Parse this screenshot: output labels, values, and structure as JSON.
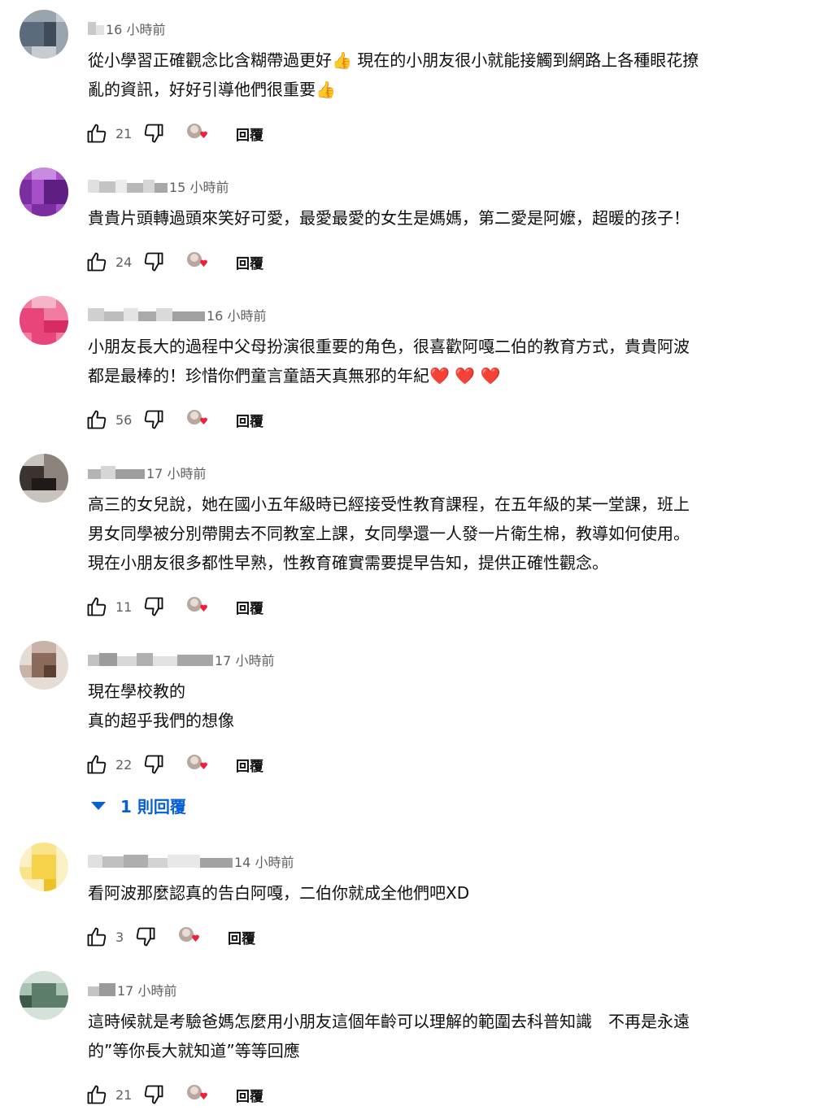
{
  "labels": {
    "reply": "回覆"
  },
  "colors": {
    "link": "#065fd4",
    "heart": "#e0245e",
    "meta": "#606060"
  },
  "comments": [
    {
      "time": "16 小時前",
      "lines": [
        "從小學習正確觀念比含糊帶過更好👍 現在的小朋友很小就能接觸到網路上各種眼花撩",
        "亂的資訊，好好引導他們很重要👍"
      ],
      "likes": "21",
      "avatar_colors": [
        "#5b6b7c",
        "#9aa4ae",
        "#3f4b58",
        "#c7ccd2"
      ]
    },
    {
      "time": "15 小時前",
      "lines": [
        "貴貴片頭轉過頭來笑好可愛，最愛最愛的女生是媽媽，第二愛是阿嬤，超暖的孩子！"
      ],
      "likes": "24",
      "avatar_colors": [
        "#7a2ea0",
        "#a64fc8",
        "#5e1f82",
        "#c98be0"
      ]
    },
    {
      "time": "16 小時前",
      "lines": [
        "小朋友長大的過程中父母扮演很重要的角色，很喜歡阿嘎二伯的教育方式，貴貴阿波",
        "都是最棒的！珍惜你們童言童語天真無邪的年紀❤️ ❤️ ❤️"
      ],
      "likes": "56",
      "avatar_colors": [
        "#e8467a",
        "#f27ba2",
        "#d62c63",
        "#f7b3c8"
      ]
    },
    {
      "time": "17 小時前",
      "lines": [
        "高三的女兒說，她在國小五年級時已經接受性教育課程，在五年級的某一堂課，班上",
        "男女同學被分別帶開去不同教室上課，女同學還一人發一片衛生棉，教導如何使用。",
        "現在小朋友很多都性早熟，性教育確實需要提早告知，提供正確性觀念。"
      ],
      "likes": "11",
      "avatar_colors": [
        "#3a3330",
        "#8c847c",
        "#1e1a18",
        "#c9c3bd"
      ]
    },
    {
      "time": "17 小時前",
      "lines": [
        "現在學校教的",
        "真的超乎我們的想像"
      ],
      "likes": "22",
      "avatar_colors": [
        "#8a6a5a",
        "#c9b3a8",
        "#5a3f33",
        "#e6dcd6"
      ],
      "replies_label": "1 則回覆"
    },
    {
      "time": "14 小時前",
      "lines": [
        "看阿波那麼認真的告白阿嘎，二伯你就成全他們吧XD"
      ],
      "likes": "3",
      "avatar_colors": [
        "#f5d24a",
        "#f9e48c",
        "#eec12a",
        "#fcf1c4"
      ]
    },
    {
      "time": "17 小時前",
      "lines": [
        "這時候就是考驗爸媽怎麼用小朋友這個年齡可以理解的範圍去科普知識　不再是永遠",
        "的”等你長大就知道”等等回應"
      ],
      "likes": "21",
      "avatar_colors": [
        "#5c7d6a",
        "#a9c2b3",
        "#3b5a48",
        "#d4e2d9"
      ]
    }
  ]
}
